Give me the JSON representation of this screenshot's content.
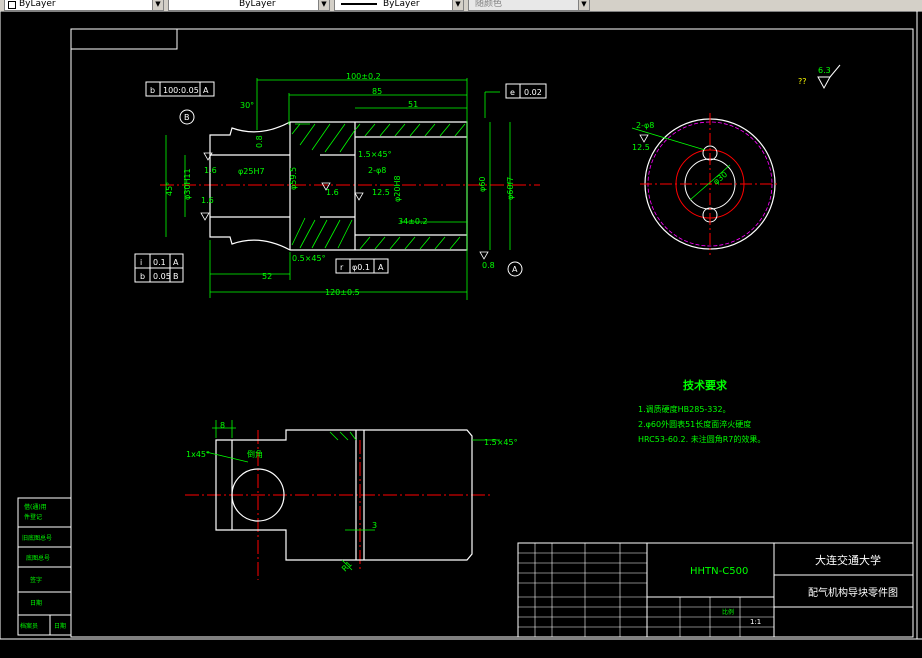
{
  "toolbar": {
    "color_combo": "ByLayer",
    "linetype_combo": "ByLayer",
    "lineweight_combo": "ByLayer",
    "plotstyle_combo": "随颜色"
  },
  "dims": {
    "d100": "100±0.2",
    "d85": "85",
    "d51": "51",
    "d52": "52",
    "d120": "120±0.5",
    "d_phi25": "φ25H7",
    "d_phi30": "φ30H11",
    "d_phi59": "φ59.5",
    "d_phi60": "φ60",
    "d_phi60f": "φ60f7",
    "d_phi20": "φ20H8",
    "d_34": "34±0.2",
    "d_45": "45°",
    "d_30": "30°",
    "d_chamfer1": "1.5×45°",
    "d_chamfer2": "0.5×45°",
    "d_2phi8": "2-φ8",
    "rough_16a": "1.6",
    "rough_16b": "1.6",
    "rough_08a": "0.8",
    "rough_08b": "0.8",
    "rough_16c": "1.6",
    "rough_125": "12.5",
    "datum_b": "B",
    "datum_a": "A"
  },
  "fcf": {
    "top_left": [
      "b",
      "100:0.05",
      "A"
    ],
    "top_right": [
      "e",
      "0.02"
    ],
    "bottom_left1": [
      "i",
      "0.1",
      "A"
    ],
    "bottom_left2": [
      "b",
      "0.05",
      "B"
    ],
    "bottom_mid": [
      "r",
      "φ0.1",
      "A"
    ]
  },
  "side": {
    "d_2phi8": "2-φ8",
    "d_125": "12.5",
    "d_phi30": "φ30"
  },
  "roughness_corner": {
    "value": "6.3",
    "note": "??"
  },
  "lower": {
    "d8": "8",
    "d1x45": "1x45°",
    "d_15x45": "1.5×45°",
    "d3": "3",
    "note_label": "倒角",
    "d_r1": "R1"
  },
  "tech": {
    "title": "技术要求",
    "line1": "1.调质硬度HB285-332。",
    "line2": "2.φ60外圆表51长度面淬火硬度",
    "line3": "HRC53-60.2. 未注圆角R7的效果。"
  },
  "title_block": {
    "drawing_no": "HHTN-C500",
    "university": "大连交通大学",
    "part_name": "配气机构导块零件图",
    "scale_label": "比例",
    "scale": "1:1"
  },
  "left_strip": [
    "借(通)用",
    "件登记",
    "旧底图总号",
    "底图总号",
    "签字",
    "日期",
    "档案员",
    "日期"
  ]
}
